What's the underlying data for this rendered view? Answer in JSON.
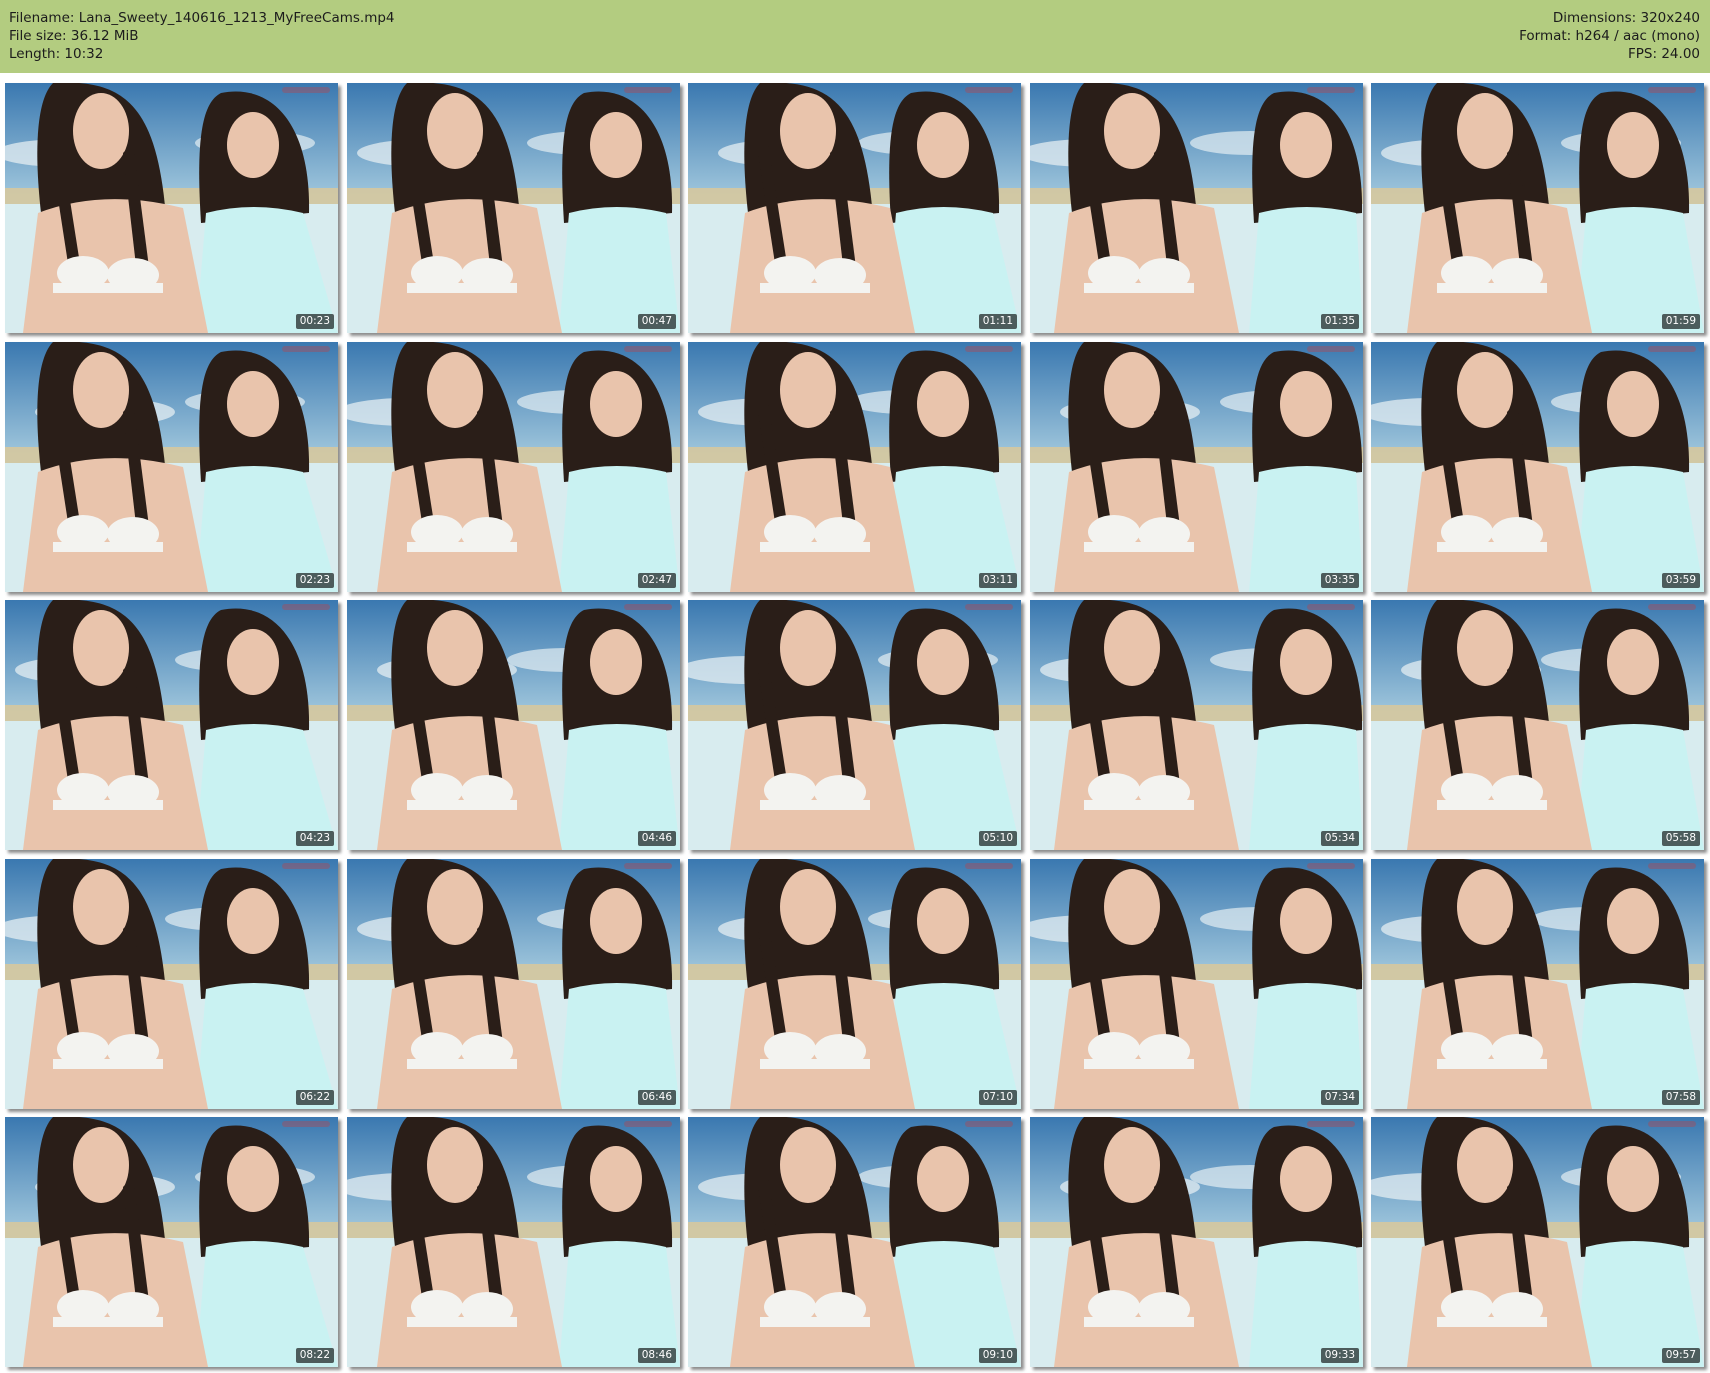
{
  "info": {
    "filename": "Filename: Lana_Sweety_140616_1213_MyFreeCams.mp4",
    "filesize": "File size: 36.12 MiB",
    "length": "Length: 10:32",
    "dimensions": "Dimensions: 320x240",
    "format": "Format: h264 / aac (mono)",
    "fps": "FPS: 24.00"
  },
  "colors": {
    "header_bg": "#b3cc80",
    "sky_top": "#3a78b0",
    "sky_mid": "#9fc6dc",
    "cloud": "#e4eef2",
    "sand": "#d9c89a",
    "wall": "#d8ecef",
    "hair": "#2a1e18",
    "skin": "#e9c4ac",
    "top_cyan": "#c9f2f2",
    "bra": "#f3f3f0"
  },
  "thumbnails": [
    {
      "time": "00:23"
    },
    {
      "time": "00:47"
    },
    {
      "time": "01:11"
    },
    {
      "time": "01:35"
    },
    {
      "time": "01:59"
    },
    {
      "time": "02:23"
    },
    {
      "time": "02:47"
    },
    {
      "time": "03:11"
    },
    {
      "time": "03:35"
    },
    {
      "time": "03:59"
    },
    {
      "time": "04:23"
    },
    {
      "time": "04:46"
    },
    {
      "time": "05:10"
    },
    {
      "time": "05:34"
    },
    {
      "time": "05:58"
    },
    {
      "time": "06:22"
    },
    {
      "time": "06:46"
    },
    {
      "time": "07:10"
    },
    {
      "time": "07:34"
    },
    {
      "time": "07:58"
    },
    {
      "time": "08:22"
    },
    {
      "time": "08:46"
    },
    {
      "time": "09:10"
    },
    {
      "time": "09:33"
    },
    {
      "time": "09:57"
    }
  ]
}
